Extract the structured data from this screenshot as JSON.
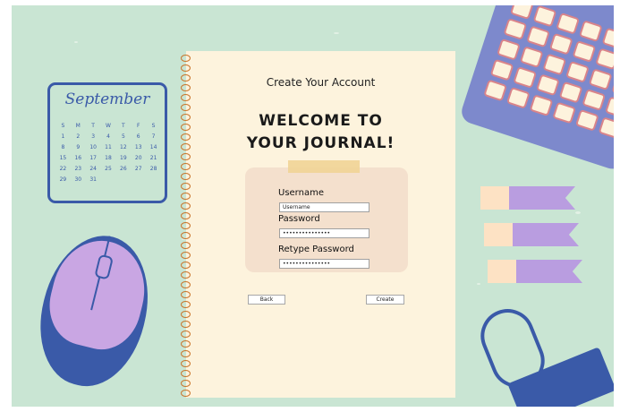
{
  "calendar": {
    "month": "September",
    "weekdays": [
      "S",
      "M",
      "T",
      "W",
      "T",
      "F",
      "S"
    ],
    "days": [
      "1",
      "2",
      "3",
      "4",
      "5",
      "6",
      "7",
      "8",
      "9",
      "10",
      "11",
      "12",
      "13",
      "14",
      "15",
      "16",
      "17",
      "18",
      "19",
      "20",
      "21",
      "22",
      "23",
      "24",
      "25",
      "26",
      "27",
      "28",
      "29",
      "30",
      "31"
    ]
  },
  "form": {
    "title": "Create Your Account",
    "welcome_line1": "WELCOME TO",
    "welcome_line2": "YOUR JOURNAL!",
    "username_label": "Username",
    "username_value": "Username",
    "password_label": "Password",
    "password_value": "•••••••••••••••",
    "retype_label": "Retype Password",
    "retype_value": "•••••••••••••••",
    "back_button": "Back",
    "create_button": "Create"
  },
  "colors": {
    "desk": "#c9e5d3",
    "paper": "#fdf3dd",
    "accent": "#3a5aa8",
    "lavender": "#c9a6e3"
  }
}
